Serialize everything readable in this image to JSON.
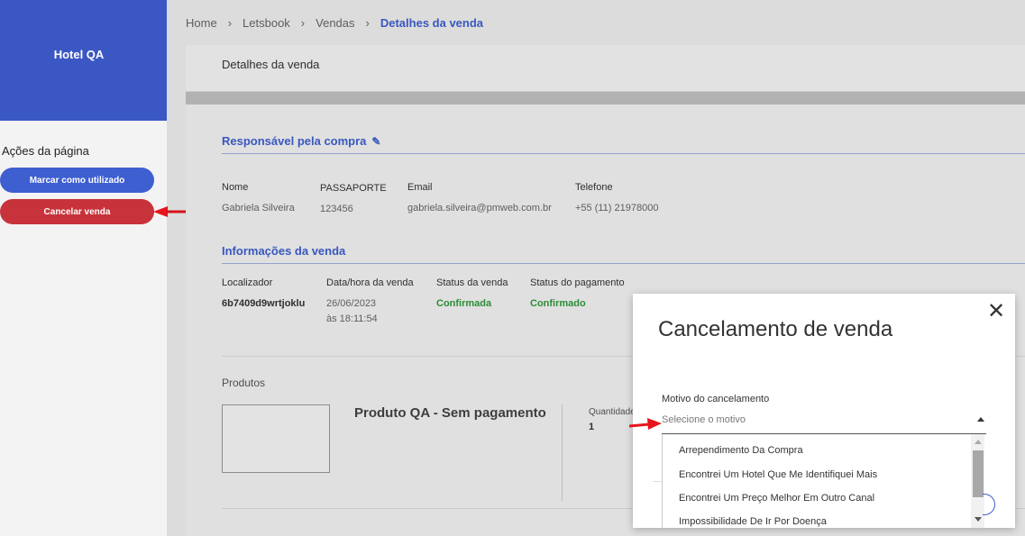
{
  "sidebar": {
    "hotel_name": "Hotel QA",
    "actions_title": "Ações da página",
    "buttons": {
      "mark_used": "Marcar como utilizado",
      "cancel_sale": "Cancelar venda"
    }
  },
  "breadcrumb": [
    "Home",
    "Letsbook",
    "Vendas",
    "Detalhes da venda"
  ],
  "page": {
    "card_title": "Detalhes da venda",
    "responsavel": {
      "title": "Responsável pela compra",
      "nome_label": "Nome",
      "nome": "Gabriela Silveira",
      "doc_label": "PASSAPORTE",
      "doc": "123456",
      "email_label": "Email",
      "email": "gabriela.silveira@pmweb.com.br",
      "telefone_label": "Telefone",
      "telefone": "+55 (11) 21978000"
    },
    "venda": {
      "title": "Informações da venda",
      "localizador_label": "Localizador",
      "localizador": "6b7409d9wrtjoklu",
      "data_label": "Data/hora da venda",
      "data": "26/06/2023",
      "hora": "às 18:11:54",
      "status_venda_label": "Status da venda",
      "status_venda": "Confirmada",
      "status_pagamento_label": "Status do pagamento",
      "status_pagamento": "Confirmado"
    },
    "produtos": {
      "label": "Produtos",
      "product_name": "Produto QA - Sem pagamento",
      "qty_label": "Quantidade",
      "qty": "1"
    }
  },
  "modal": {
    "title": "Cancelamento de venda",
    "field_label": "Motivo do cancelamento",
    "placeholder": "Selecione o motivo",
    "options": [
      "Arrependimento Da Compra",
      "Encontrei Um Hotel Que Me Identifiquei Mais",
      "Encontrei Um Preço Melhor Em Outro Canal",
      "Impossibilidade De Ir Por Doença"
    ]
  },
  "colors": {
    "brand_blue": "#3b57c4",
    "danger_red": "#c8323a",
    "success_green": "#2e9a3b",
    "annotation_arrow": "#e8141b"
  }
}
